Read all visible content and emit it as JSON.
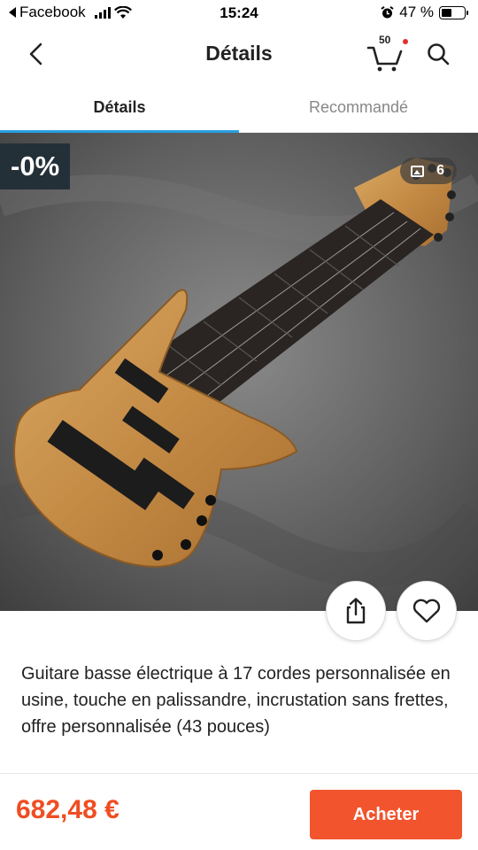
{
  "status_bar": {
    "back_app": "Facebook",
    "time": "15:24",
    "battery_percent": "47 %",
    "battery_level": 0.47
  },
  "header": {
    "title": "Détails",
    "cart_count": "50"
  },
  "tabs": [
    {
      "label": "Détails",
      "active": true
    },
    {
      "label": "Recommandé",
      "active": false
    }
  ],
  "product": {
    "discount_badge": "-0%",
    "image_count": "6",
    "title": "Guitare basse électrique à 17 cordes personnalisée en usine, touche en palissandre, incrustation sans frettes, offre personnalisée (43 pouces)",
    "price": "682,48 €"
  },
  "actions": {
    "buy_label": "Acheter"
  },
  "colors": {
    "accent_tab": "#2a9fe0",
    "price": "#f04d22",
    "buy_button": "#f2542d",
    "discount_badge_bg": "#243038"
  }
}
